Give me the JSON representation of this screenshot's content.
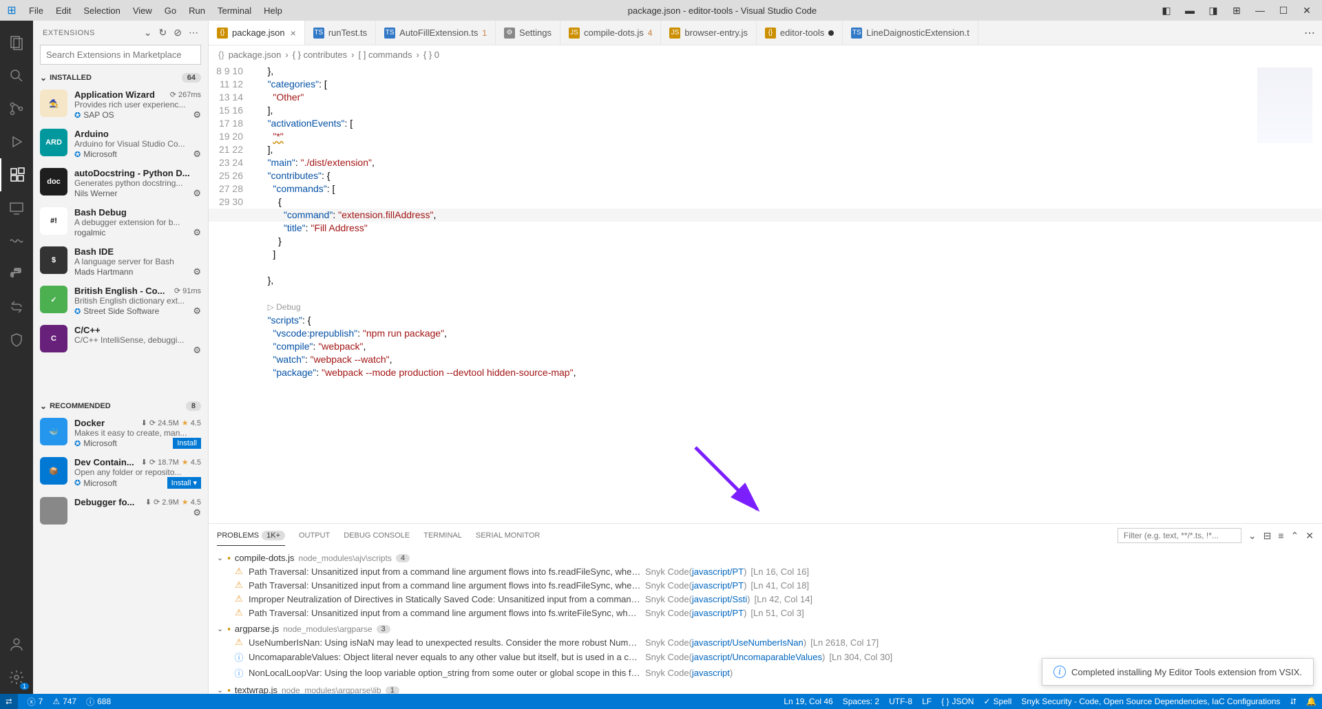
{
  "titlebar": {
    "menus": [
      "File",
      "Edit",
      "Selection",
      "View",
      "Go",
      "Run",
      "Terminal",
      "Help"
    ],
    "title": "package.json - editor-tools - Visual Studio Code"
  },
  "sidebar": {
    "header": "EXTENSIONS",
    "searchPlaceholder": "Search Extensions in Marketplace",
    "sections": {
      "installed": {
        "label": "INSTALLED",
        "count": "64"
      },
      "recommended": {
        "label": "RECOMMENDED",
        "count": "8"
      }
    },
    "installed": [
      {
        "name": "Application Wizard",
        "meta": "267ms",
        "desc": "Provides rich user experienc...",
        "pub": "SAP OS",
        "verified": true,
        "iconBg": "#f5e6c8",
        "iconText": "🧙"
      },
      {
        "name": "Arduino",
        "meta": "",
        "desc": "Arduino for Visual Studio Co...",
        "pub": "Microsoft",
        "verified": true,
        "iconBg": "#00979d",
        "iconText": "ARD"
      },
      {
        "name": "autoDocstring - Python D...",
        "meta": "",
        "desc": "Generates python docstring...",
        "pub": "Nils Werner",
        "verified": false,
        "iconBg": "#1e1e1e",
        "iconText": "doc"
      },
      {
        "name": "Bash Debug",
        "meta": "",
        "desc": "A debugger extension for b...",
        "pub": "rogalmic",
        "verified": false,
        "iconBg": "#fff",
        "iconText": "#!"
      },
      {
        "name": "Bash IDE",
        "meta": "",
        "desc": "A language server for Bash",
        "pub": "Mads Hartmann",
        "verified": false,
        "iconBg": "#333",
        "iconText": "$"
      },
      {
        "name": "British English - Co...",
        "meta": "91ms",
        "desc": "British English dictionary ext...",
        "pub": "Street Side Software",
        "verified": true,
        "iconBg": "#4caf50",
        "iconText": "✓"
      },
      {
        "name": "C/C++",
        "meta": "",
        "desc": "C/C++ IntelliSense, debuggi...",
        "pub": "",
        "verified": false,
        "iconBg": "#68217a",
        "iconText": "C"
      }
    ],
    "recommended": [
      {
        "name": "Docker",
        "meta": "24.5M",
        "rating": "4.5",
        "desc": "Makes it easy to create, man...",
        "pub": "Microsoft",
        "verified": true,
        "iconBg": "#2496ed",
        "iconText": "🐳",
        "install": true
      },
      {
        "name": "Dev Contain...",
        "meta": "18.7M",
        "rating": "4.5",
        "desc": "Open any folder or reposito...",
        "pub": "Microsoft",
        "verified": true,
        "iconBg": "#0078d4",
        "iconText": "📦",
        "install": true,
        "split": true
      },
      {
        "name": "Debugger fo...",
        "meta": "2.9M",
        "rating": "4.5",
        "desc": "",
        "pub": "",
        "verified": false,
        "iconBg": "#888",
        "iconText": "",
        "install": false
      }
    ]
  },
  "tabs": [
    {
      "icon": "{}",
      "iconColor": "#cc8f00",
      "label": "package.json",
      "active": true,
      "close": true
    },
    {
      "icon": "TS",
      "iconColor": "#3178c6",
      "label": "runTest.ts"
    },
    {
      "icon": "TS",
      "iconColor": "#3178c6",
      "label": "AutoFillExtension.ts",
      "badge": "1"
    },
    {
      "icon": "⚙",
      "iconColor": "#888",
      "label": "Settings"
    },
    {
      "icon": "JS",
      "iconColor": "#cc8f00",
      "label": "compile-dots.js",
      "badge": "4"
    },
    {
      "icon": "JS",
      "iconColor": "#cc8f00",
      "label": "browser-entry.js"
    },
    {
      "icon": "{}",
      "iconColor": "#cc8f00",
      "label": "editor-tools",
      "dot": true
    },
    {
      "icon": "TS",
      "iconColor": "#3178c6",
      "label": "LineDaignosticExtension.t"
    }
  ],
  "breadcrumbs": [
    "package.json",
    "{ } contributes",
    "[ ] commands",
    "{ } 0"
  ],
  "code": {
    "lines": [
      {
        "n": 8,
        "html": "    <span class='tk-pun'>},</span>"
      },
      {
        "n": 9,
        "html": "    <span class='tk-key'>\"categories\"</span><span class='tk-pun'>: [</span>"
      },
      {
        "n": 10,
        "html": "      <span class='tk-str'>\"Other\"</span>"
      },
      {
        "n": 11,
        "html": "    <span class='tk-pun'>],</span>"
      },
      {
        "n": 12,
        "html": "    <span class='tk-key'>\"activationEvents\"</span><span class='tk-pun'>: [</span>"
      },
      {
        "n": 13,
        "html": "      <span class='tk-str squiggle'>\"*\"</span>"
      },
      {
        "n": 14,
        "html": "    <span class='tk-pun'>],</span>"
      },
      {
        "n": 15,
        "html": "    <span class='tk-key'>\"main\"</span><span class='tk-pun'>: </span><span class='tk-str'>\"./dist/extension\"</span><span class='tk-pun'>,</span>"
      },
      {
        "n": 16,
        "html": "    <span class='tk-key'>\"contributes\"</span><span class='tk-pun'>: {</span>"
      },
      {
        "n": 17,
        "html": "      <span class='tk-key'>\"commands\"</span><span class='tk-pun'>: [</span>"
      },
      {
        "n": 18,
        "html": "        <span class='tk-pun'>{</span>"
      },
      {
        "n": 19,
        "html": "          <span class='tk-key'>\"command\"</span><span class='tk-pun'>: </span><span class='tk-str'>\"extension.fillAddress\"</span><span class='tk-pun'>,</span>"
      },
      {
        "n": 20,
        "html": "          <span class='tk-key'>\"title\"</span><span class='tk-pun'>: </span><span class='tk-str'>\"Fill Address\"</span>"
      },
      {
        "n": 21,
        "html": "        <span class='tk-pun'>}</span>"
      },
      {
        "n": 22,
        "html": "      <span class='tk-pun'>]</span>"
      },
      {
        "n": 23,
        "html": ""
      },
      {
        "n": 24,
        "html": "    <span class='tk-pun'>},</span>"
      },
      {
        "n": 25,
        "html": ""
      }
    ],
    "debugLabel": "Debug",
    "lines2": [
      {
        "n": 26,
        "html": "    <span class='tk-key'>\"scripts\"</span><span class='tk-pun'>: {</span>"
      },
      {
        "n": 27,
        "html": "      <span class='tk-key'>\"vscode:prepublish\"</span><span class='tk-pun'>: </span><span class='tk-str'>\"npm run package\"</span><span class='tk-pun'>,</span>"
      },
      {
        "n": 28,
        "html": "      <span class='tk-key'>\"compile\"</span><span class='tk-pun'>: </span><span class='tk-str'>\"webpack\"</span><span class='tk-pun'>,</span>"
      },
      {
        "n": 29,
        "html": "      <span class='tk-key'>\"watch\"</span><span class='tk-pun'>: </span><span class='tk-str'>\"webpack --watch\"</span><span class='tk-pun'>,</span>"
      },
      {
        "n": 30,
        "html": "      <span class='tk-key'>\"package\"</span><span class='tk-pun'>: </span><span class='tk-str'>\"webpack --mode production --devtool hidden-source-map\"</span><span class='tk-pun'>,</span>"
      }
    ]
  },
  "panel": {
    "tabs": [
      "PROBLEMS",
      "OUTPUT",
      "DEBUG CONSOLE",
      "TERMINAL",
      "SERIAL MONITOR"
    ],
    "problemsBadge": "1K+",
    "filterPlaceholder": "Filter (e.g. text, **/*.ts, !*...",
    "groups": [
      {
        "file": "compile-dots.js",
        "path": "node_modules\\ajv\\scripts",
        "count": "4",
        "items": [
          {
            "type": "warn",
            "msg": "Path Traversal: Unsanitized input from a command line argument flows into fs.readFileSync, where it ...",
            "src": "Snyk Code",
            "link": "javascript/PT",
            "loc": "[Ln 16, Col 16]"
          },
          {
            "type": "warn",
            "msg": "Path Traversal: Unsanitized input from a command line argument flows into fs.readFileSync, where it ...",
            "src": "Snyk Code",
            "link": "javascript/PT",
            "loc": "[Ln 41, Col 18]"
          },
          {
            "type": "warn",
            "msg": "Improper Neutralization of Directives in Statically Saved Code: Unsanitized input from a command lin...",
            "src": "Snyk Code",
            "link": "javascript/Ssti",
            "loc": "[Ln 42, Col 14]"
          },
          {
            "type": "warn",
            "msg": "Path Traversal: Unsanitized input from a command line argument flows into fs.writeFileSync, where it...",
            "src": "Snyk Code",
            "link": "javascript/PT",
            "loc": "[Ln 51, Col 3]"
          }
        ]
      },
      {
        "file": "argparse.js",
        "path": "node_modules\\argparse",
        "count": "3",
        "items": [
          {
            "type": "warn",
            "msg": "UseNumberIsNan: Using isNaN may lead to unexpected results. Consider the more robust Number.isNaN in...",
            "src": "Snyk Code",
            "link": "javascript/UseNumberIsNan",
            "loc": "[Ln 2618, Col 17]"
          },
          {
            "type": "info",
            "msg": "UncomaparableValues: Object literal never equals to any other value but itself, but is used in a com...",
            "src": "Snyk Code",
            "link": "javascript/UncomaparableValues",
            "loc": "[Ln 304, Col 30]"
          },
          {
            "type": "info",
            "msg": "NonLocalLoopVar: Using the loop variable option_string from some outer or global scope in this for o...",
            "src": "Snyk Code",
            "link": "javascript",
            "loc": ""
          }
        ]
      },
      {
        "file": "textwrap.js",
        "path": "node_modules\\argparse\\lib",
        "count": "1",
        "items": []
      }
    ]
  },
  "toast": "Completed installing My Editor Tools extension from VSIX.",
  "status": {
    "errors": "7",
    "warnings": "747",
    "infos": "688",
    "cursor": "Ln 19, Col 46",
    "spaces": "Spaces: 2",
    "encoding": "UTF-8",
    "eol": "LF",
    "lang": "JSON",
    "spell": "Spell",
    "snyk": "Snyk Security - Code, Open Source Dependencies, IaC Configurations"
  }
}
